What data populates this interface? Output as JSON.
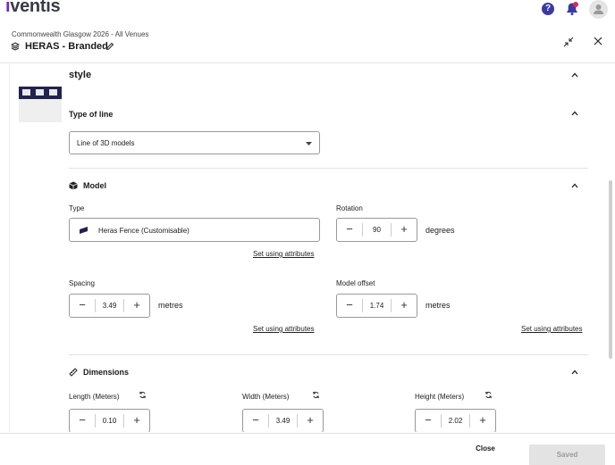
{
  "app": {
    "logo": "iventis"
  },
  "topbar": {
    "help_icon": "question-circle-icon",
    "bell_icon": "bell-icon",
    "avatar_icon": "user-avatar-icon"
  },
  "header": {
    "breadcrumb": "Commonwealth Glasgow 2026 - All Venues",
    "title": "HERAS - Branded"
  },
  "style": {
    "title": "style",
    "type_of_line": {
      "title": "Type of line",
      "value": "Line of 3D models"
    }
  },
  "model": {
    "title": "Model",
    "type_label": "Type",
    "type_value": "Heras Fence (Customisable)",
    "rotation_label": "Rotation",
    "rotation_value": "90",
    "rotation_unit": "degrees",
    "set_using_attributes": "Set using attributes",
    "spacing_label": "Spacing",
    "spacing_value": "3.49",
    "spacing_unit": "metres",
    "offset_label": "Model offset",
    "offset_value": "1.74",
    "offset_unit": "metres",
    "minus": "−",
    "plus": "+"
  },
  "dimensions": {
    "title": "Dimensions",
    "length_label": "Length (Meters)",
    "length_value": "0.10",
    "width_label": "Width (Meters)",
    "width_value": "3.49",
    "height_label": "Height (Meters)",
    "height_value": "2.02"
  },
  "footer": {
    "close_label": "Close",
    "saved_label": "Saved"
  },
  "colors": {
    "brand": "#6a2cc0",
    "help": "#3b3a9e",
    "notification": "#e0245e"
  }
}
